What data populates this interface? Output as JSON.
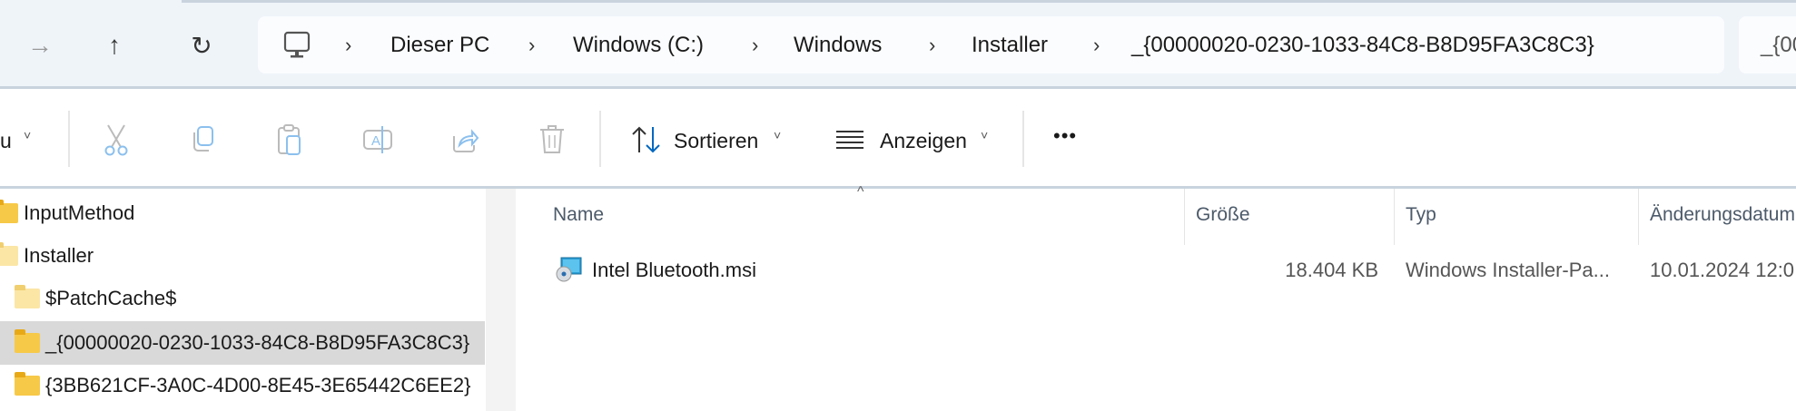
{
  "nav": {
    "forward": "forward-icon",
    "up": "up-icon",
    "refresh": "refresh-icon"
  },
  "breadcrumb": {
    "root_icon": "monitor-icon",
    "items": [
      "Dieser PC",
      "Windows (C:)",
      "Windows",
      "Installer",
      "_{00000020-0230-1033-84C8-B8D95FA3C8C3}"
    ],
    "separator": "›"
  },
  "search": {
    "value": "_{00"
  },
  "commandbar": {
    "new_label": "u",
    "sort_label": "Sortieren",
    "view_label": "Anzeigen",
    "more": "•••",
    "chevron": "˅"
  },
  "sidebar": {
    "items": [
      {
        "label": "InputMethod"
      },
      {
        "label": "Installer"
      },
      {
        "label": "$PatchCache$"
      },
      {
        "label": "_{00000020-0230-1033-84C8-B8D95FA3C8C3}"
      },
      {
        "label": "{3BB621CF-3A0C-4D00-8E45-3E65442C6EE2}"
      }
    ]
  },
  "columns": {
    "name": "Name",
    "size": "Größe",
    "type": "Typ",
    "modified": "Änderungsdatum",
    "sort_indicator": "^"
  },
  "files": [
    {
      "name": "Intel Bluetooth.msi",
      "size": "18.404 KB",
      "type": "Windows Installer-Pa...",
      "modified": "10.01.2024 12:0"
    }
  ],
  "colors": {
    "accent": "#0067c0",
    "selection": "#d9d9d9",
    "topbar": "#eff4f9"
  }
}
